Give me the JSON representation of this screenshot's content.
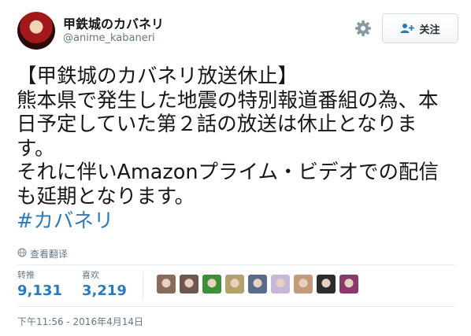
{
  "user": {
    "name": "甲鉄城のカバネリ",
    "handle": "@anime_kabaneri"
  },
  "actions": {
    "settings_icon": "gear-icon",
    "follow_label": "关注",
    "follow_icon": "add-user-icon"
  },
  "tweet": {
    "lines": [
      "【甲鉄城のカバネリ放送休止】",
      "熊本県で発生した地震の特別報道番組の為、本",
      "日予定していた第２話の放送は休止となりま",
      "す。",
      "それに伴いAmazonプライム・ビデオでの配信",
      "も延期となります。"
    ],
    "hashtag": "#カバネリ"
  },
  "translate": {
    "label": "查看翻译",
    "icon": "globe-icon"
  },
  "stats": {
    "retweets": {
      "label": "转推",
      "value": "9,131"
    },
    "likes": {
      "label": "喜欢",
      "value": "3,219"
    }
  },
  "likers": {
    "count": 9,
    "colors": [
      "#8a6a58",
      "#6e5a4c",
      "#3f8f3a",
      "#b3a06a",
      "#5c6a8a",
      "#c8b8d8",
      "#c49a7a",
      "#2c2c2c",
      "#8a3a6a"
    ]
  },
  "timestamp": "下午11:56 - 2016年4月14日",
  "colors": {
    "link": "#2b7bb9",
    "muted": "#657786",
    "text": "#14171a"
  }
}
